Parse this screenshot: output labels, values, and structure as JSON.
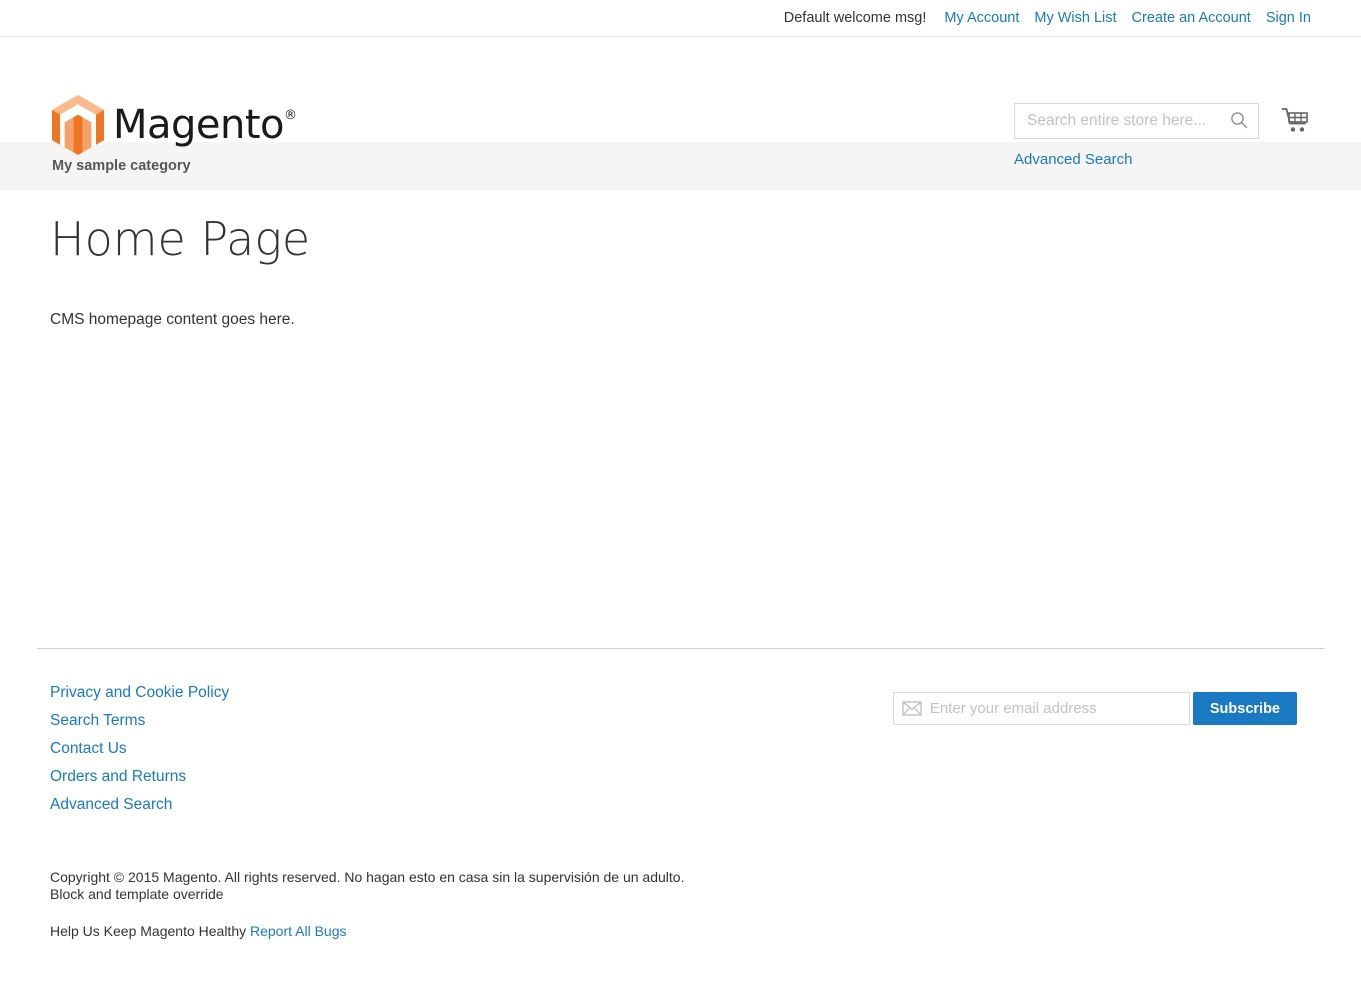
{
  "top_panel": {
    "welcome_message": "Default welcome msg!",
    "links": [
      {
        "label": "My Account"
      },
      {
        "label": "My Wish List"
      },
      {
        "label": "Create an Account"
      },
      {
        "label": "Sign In"
      }
    ]
  },
  "header": {
    "logo_text": "Magento",
    "logo_registered": "®",
    "logo_icon": "magento-hexagon-icon",
    "search": {
      "placeholder": "Search entire store here...",
      "value": "",
      "icon": "search-icon"
    },
    "advanced_search_label": "Advanced Search",
    "cart_icon": "shopping-cart-icon"
  },
  "nav": {
    "items": [
      {
        "label": "My sample category"
      }
    ]
  },
  "main": {
    "page_title": "Home Page",
    "content": "CMS homepage content goes here."
  },
  "footer": {
    "links": [
      {
        "label": "Privacy and Cookie Policy"
      },
      {
        "label": "Search Terms"
      },
      {
        "label": "Contact Us"
      },
      {
        "label": "Orders and Returns"
      },
      {
        "label": "Advanced Search"
      }
    ],
    "newsletter": {
      "placeholder": "Enter your email address",
      "value": "",
      "icon": "envelope-icon",
      "subscribe_label": "Subscribe"
    },
    "copyright_line1": "Copyright © 2015 Magento. All rights reserved. No hagan esto en casa sin la supervisión de un adulto.",
    "copyright_line2": "Block and template override",
    "bugs_text": "Help Us Keep Magento Healthy",
    "bugs_link_label": "Report All Bugs"
  },
  "colors": {
    "link_blue": "#1979c3",
    "brand_orange": "#f26322",
    "nav_background": "#f5f5f5",
    "text_dark": "#333333"
  }
}
